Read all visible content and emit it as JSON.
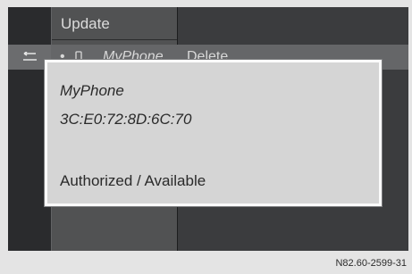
{
  "menu": {
    "update_label": "Update"
  },
  "list": {
    "bullet": "•",
    "device_name": "MyPhone",
    "delete_label": "Delete"
  },
  "popup": {
    "device_name": "MyPhone",
    "address": "3C:E0:72:8D:6C:70",
    "status": "Authorized / Available"
  },
  "icons": {
    "back": "back-arrow-icon",
    "phone": "phone-icon"
  },
  "caption": "N82.60-2599-31"
}
